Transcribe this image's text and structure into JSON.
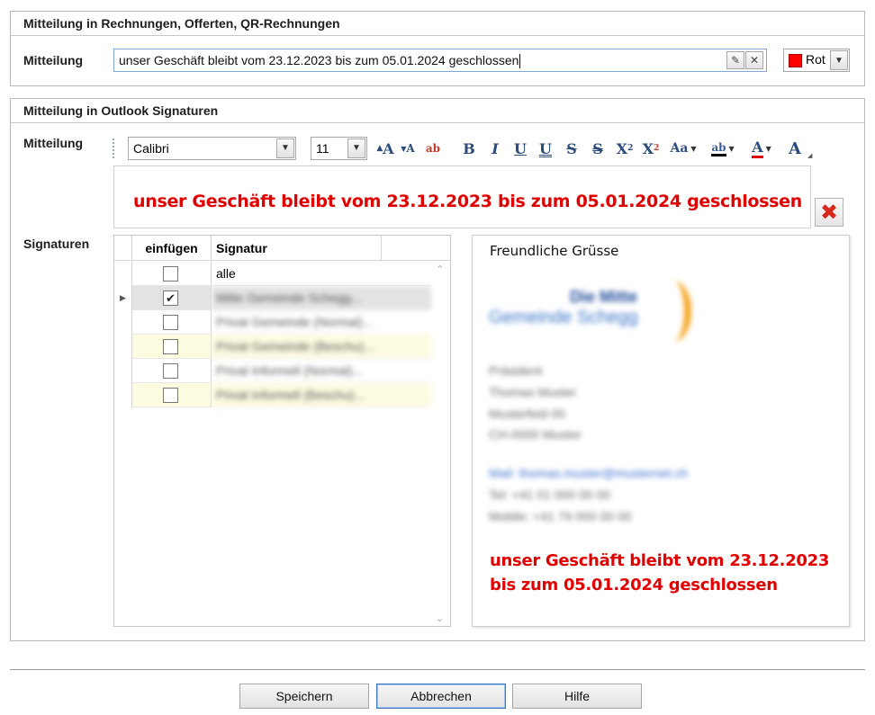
{
  "invoice_section": {
    "title": "Mitteilung in Rechnungen, Offerten, QR-Rechnungen",
    "label": "Mitteilung",
    "message_value": "unser Geschäft bleibt vom 23.12.2023 bis zum 05.01.2024 geschlossen",
    "color_name": "Rot",
    "color_hex": "#ff0000",
    "edit_icon": "pencil-icon",
    "clear_icon": "close-icon"
  },
  "outlook_section": {
    "title": "Mitteilung in Outlook Signaturen",
    "label": "Mitteilung",
    "font_family": "Calibri",
    "font_size": "11",
    "toolbar_icons": [
      "grow-font-icon",
      "shrink-font-icon",
      "clear-format-icon",
      "bold-icon",
      "italic-icon",
      "underline-icon",
      "double-underline-icon",
      "strikethrough-icon",
      "double-strikethrough-icon",
      "superscript-icon",
      "subscript-icon",
      "change-case-icon",
      "highlight-icon",
      "font-color-icon",
      "text-effects-icon"
    ],
    "editor_text": "unser Geschäft bleibt vom 23.12.2023 bis zum 05.01.2024 geschlossen",
    "editor_color": "#e00000",
    "delete_icon": "delete-x-icon",
    "signatures_label": "Signaturen",
    "grid": {
      "columns": [
        "einfügen",
        "Signatur"
      ],
      "rows": [
        {
          "checked": false,
          "name": "alle",
          "blurred": false,
          "style": "plain"
        },
        {
          "checked": true,
          "name": "Mitte Gemeinde Schegg...",
          "blurred": true,
          "style": "selected"
        },
        {
          "checked": false,
          "name": "Privat Gemeinde (Normal)...",
          "blurred": true,
          "style": "plain"
        },
        {
          "checked": false,
          "name": "Privat Gemeinde (Beschu)...",
          "blurred": true,
          "style": "yellow"
        },
        {
          "checked": false,
          "name": "Privat Informell (Normal)...",
          "blurred": true,
          "style": "plain"
        },
        {
          "checked": false,
          "name": "Privat Informell (Beschu)...",
          "blurred": true,
          "style": "yellow"
        }
      ]
    },
    "preview": {
      "greeting": "Freundliche Grüsse",
      "logo_line1": "Die Mitte",
      "logo_line2": "Gemeinde Schegg",
      "lines": [
        "Präsident",
        "Thomas Muster",
        "Musterfeld 00",
        "CH-0000 Muster",
        "Mail:     thomas.muster@musternet.ch",
        "Tel:      +41 01 000 00 00",
        "Mobile:  +41 79 000 00 00"
      ],
      "warning_line1": "unser Geschäft bleibt vom 23.12.2023",
      "warning_line2": "bis zum 05.01.2024 geschlossen"
    }
  },
  "buttons": {
    "save": "Speichern",
    "cancel": "Abbrechen",
    "help": "Hilfe"
  }
}
